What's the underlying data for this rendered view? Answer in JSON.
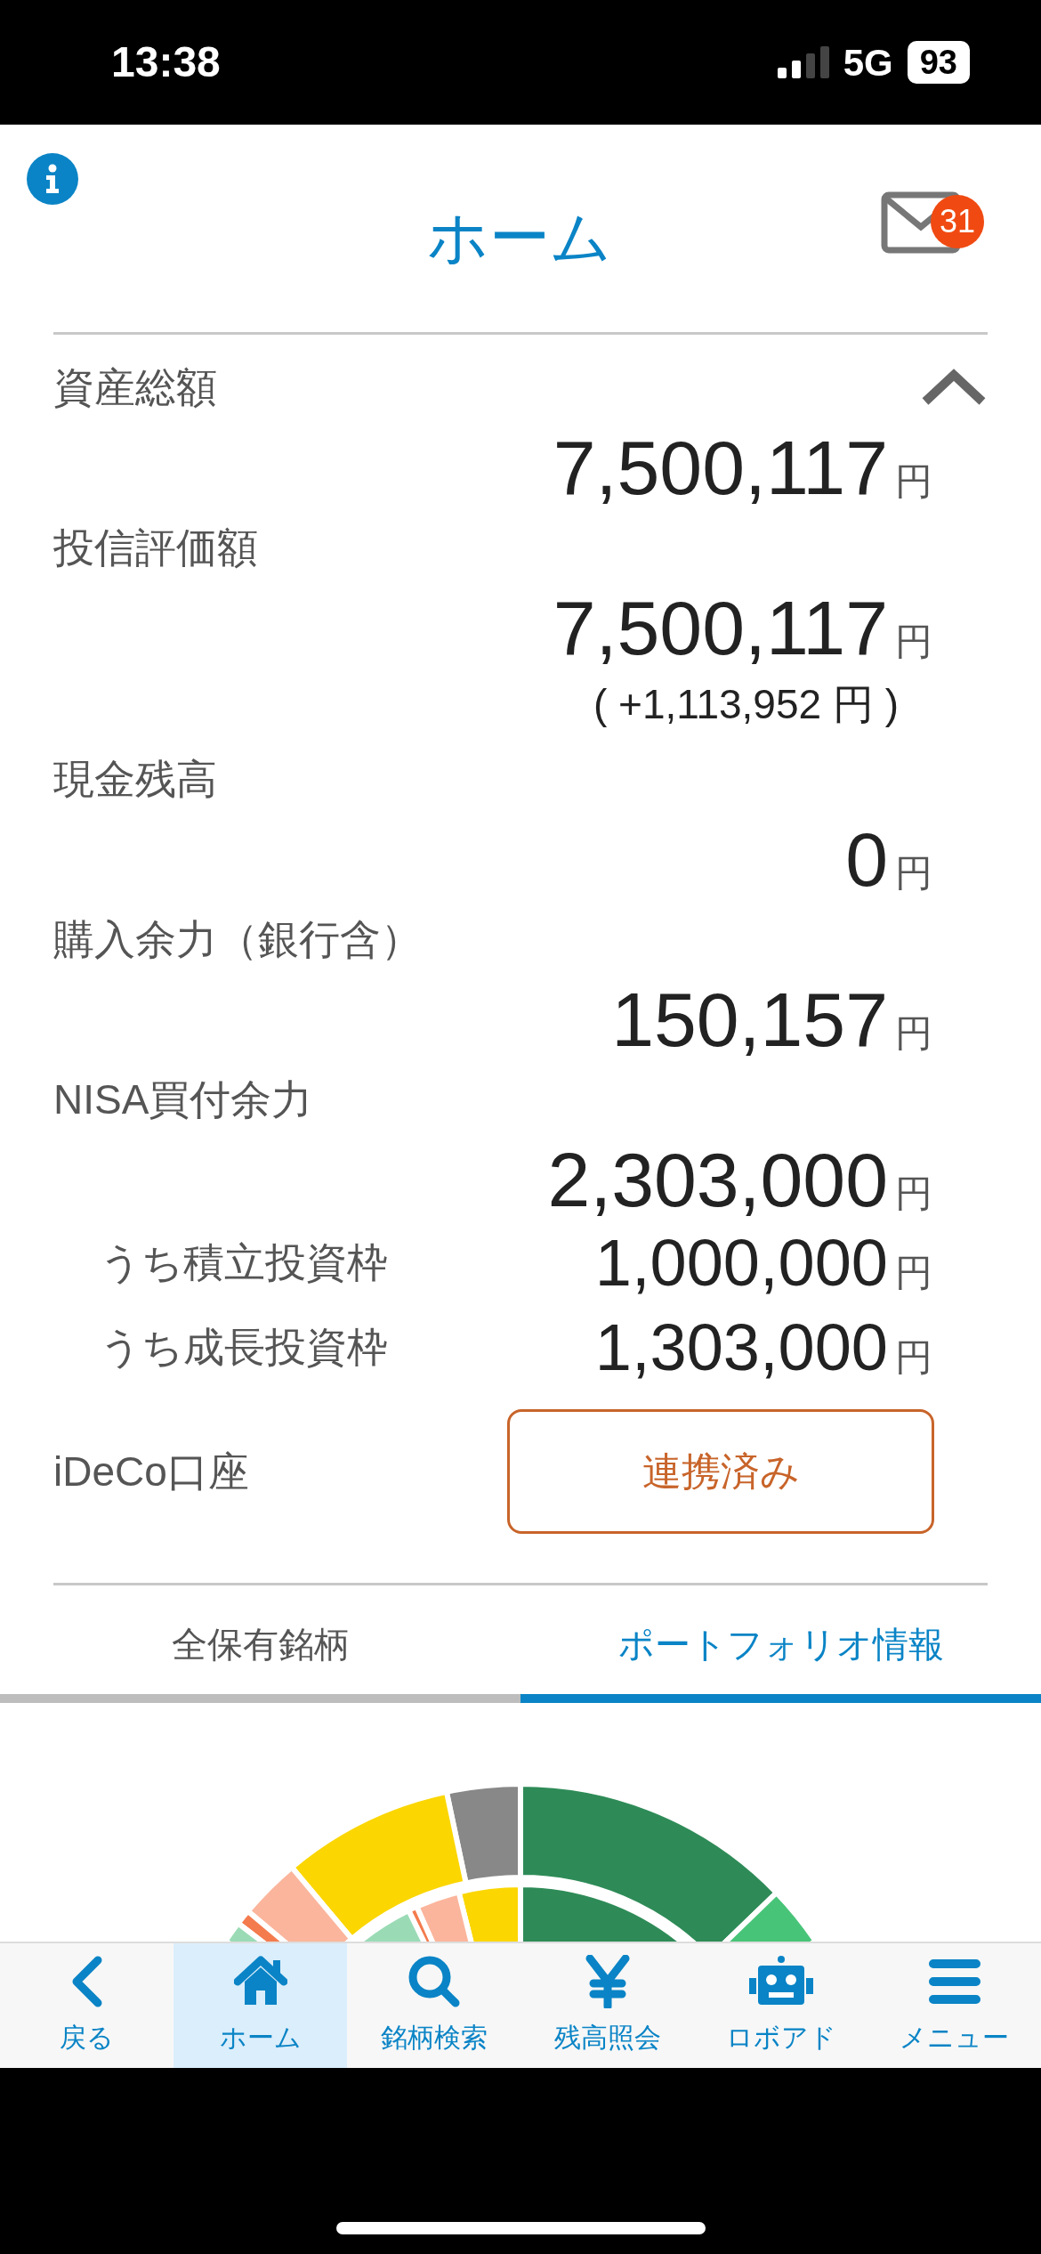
{
  "status_bar": {
    "time": "13:38",
    "network": "5G",
    "battery": "93"
  },
  "header": {
    "title": "ホーム",
    "unread_count": "31"
  },
  "summary": {
    "expanded": true,
    "items": [
      {
        "kind": "amount",
        "label": "資産総額",
        "value": "7,500,117",
        "unit": "円"
      },
      {
        "kind": "amount",
        "label": "投信評価額",
        "value": "7,500,117",
        "unit": "円",
        "change": "( +1,113,952 円 )"
      },
      {
        "kind": "amount",
        "label": "現金残高",
        "value": "0",
        "unit": "円"
      },
      {
        "kind": "amount",
        "label": "購入余力（銀行含）",
        "value": "150,157",
        "unit": "円"
      },
      {
        "kind": "amount",
        "label": "NISA買付余力",
        "value": "2,303,000",
        "unit": "円"
      },
      {
        "kind": "sub",
        "label": "うち積立投資枠",
        "value": "1,000,000",
        "unit": "円"
      },
      {
        "kind": "sub",
        "label": "うち成長投資枠",
        "value": "1,303,000",
        "unit": "円"
      },
      {
        "kind": "link",
        "label": "iDeCo口座",
        "button": "連携済み"
      }
    ]
  },
  "tabs": [
    {
      "label": "全保有銘柄",
      "selected": false
    },
    {
      "label": "ポートフォリオ情報",
      "selected": true
    }
  ],
  "nav": [
    {
      "label": "戻る",
      "selected": false
    },
    {
      "label": "ホーム",
      "selected": true
    },
    {
      "label": "銘柄検索",
      "selected": false
    },
    {
      "label": "残高照会",
      "selected": false
    },
    {
      "label": "ロボアド",
      "selected": false
    },
    {
      "label": "メニュー",
      "selected": false
    }
  ]
}
